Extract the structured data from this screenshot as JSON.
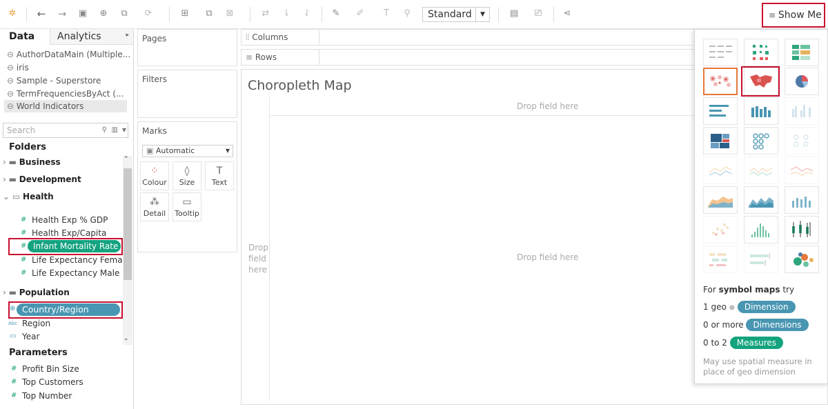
{
  "toolbar": {
    "view_select": "Standard",
    "show_me_label": "Show Me"
  },
  "data_pane": {
    "tab_data": "Data",
    "tab_analytics": "Analytics",
    "sources": [
      "AuthorDataMain (Multiple...",
      "iris",
      "Sample - Superstore",
      "TermFrequenciesByAct (...",
      "World Indicators"
    ],
    "search_placeholder": "Search",
    "folders_title": "Folders",
    "folder_business": "Business",
    "folder_development": "Development",
    "folder_health": "Health",
    "health_fields": [
      "Health Exp % GDP",
      "Health Exp/Capita",
      "Infant Mortality Rate",
      "Life Expectancy Female",
      "Life Expectancy Male"
    ],
    "folder_population": "Population",
    "country_field": "Country/Region",
    "region_field": "Region",
    "region_type": "Abc",
    "year_field": "Year",
    "parameters_title": "Parameters",
    "parameters": [
      "Profit Bin Size",
      "Top Customers",
      "Top Number"
    ]
  },
  "cards": {
    "pages": "Pages",
    "filters": "Filters",
    "marks": "Marks",
    "mark_type": "Automatic",
    "btn_colour": "Colour",
    "btn_size": "Size",
    "btn_text": "Text",
    "btn_detail": "Detail",
    "btn_tooltip": "Tooltip"
  },
  "shelves": {
    "columns": "Columns",
    "rows": "Rows"
  },
  "view": {
    "title": "Choropleth Map",
    "drop_top": "Drop field here",
    "drop_center": "Drop field here",
    "drop_left_1": "Drop",
    "drop_left_2": "field",
    "drop_left_3": "here"
  },
  "show_me": {
    "hint_prefix": "For ",
    "hint_bold": "symbol maps",
    "hint_suffix": " try",
    "req1_prefix": "1 geo",
    "req1_pill": "Dimension",
    "req2_prefix": "0 or more",
    "req2_pill": "Dimensions",
    "req3_prefix": "0 to 2",
    "req3_pill": "Measures",
    "note": "May use spatial measure in place of geo dimension"
  },
  "colors": {
    "measure_green": "#14a37f",
    "dimension_blue": "#4996b2",
    "highlight_red": "#c8102e"
  }
}
